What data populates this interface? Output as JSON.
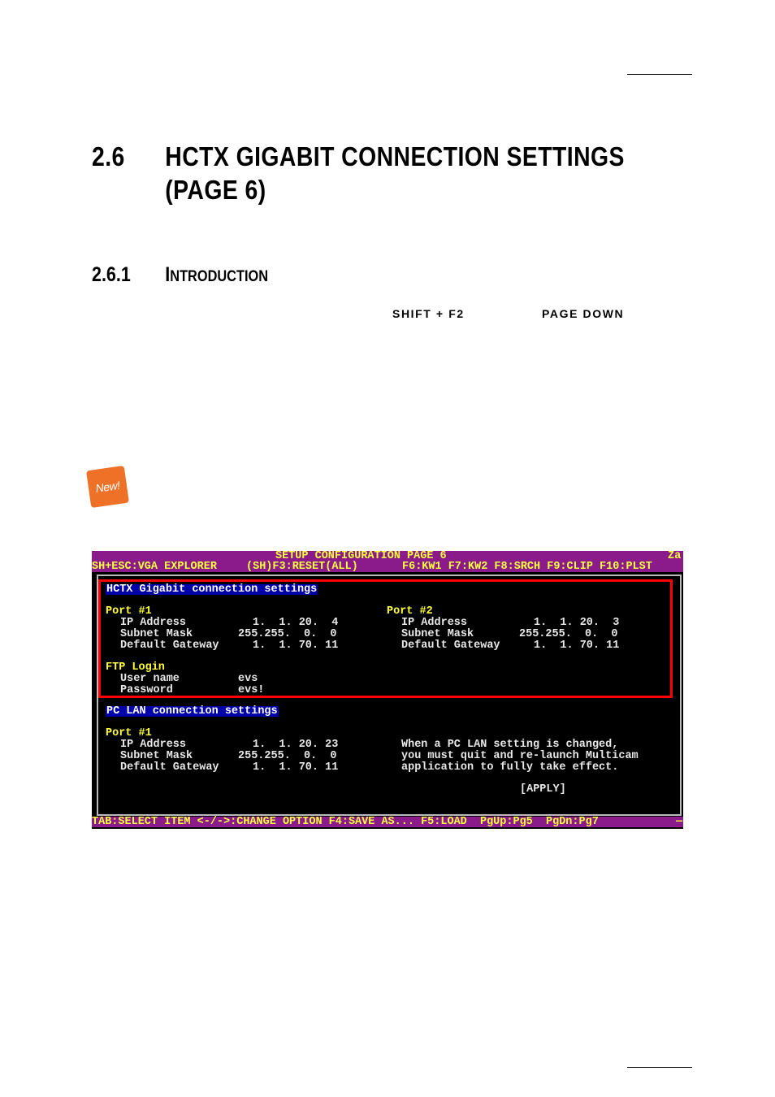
{
  "heading": {
    "number": "2.6",
    "title_line1": "HCTX GIGABIT CONNECTION SETTINGS",
    "title_line2": "(PAGE 6)"
  },
  "subheading": {
    "number": "2.6.1",
    "cap": "I",
    "rest": "NTRODUCTION"
  },
  "keys": {
    "shift_f2": "SHIFT + F2",
    "page_down": "PAGE DOWN"
  },
  "badge": {
    "label": "New!"
  },
  "screen": {
    "title": "SETUP CONFIGURATION PAGE 6",
    "title_right": "Za",
    "menu_left": "SH+ESC:VGA EXPLORER",
    "menu_mid": "(SH)F3:RESET(ALL)",
    "menu_right": "F6:KW1 F7:KW2 F8:SRCH F9:CLIP F10:PLST",
    "hctx": {
      "section_title": "HCTX Gigabit connection settings",
      "port1": {
        "label": "Port #1",
        "ip_label": "IP Address",
        "ip_value": "1.  1. 20.  4",
        "mask_label": "Subnet Mask",
        "mask_value": "255.255.  0.  0",
        "gw_label": "Default Gateway",
        "gw_value": "1.  1. 70. 11"
      },
      "port2": {
        "label": "Port #2",
        "ip_label": "IP Address",
        "ip_value": "1.  1. 20.  3",
        "mask_label": "Subnet Mask",
        "mask_value": "255.255.  0.  0",
        "gw_label": "Default Gateway",
        "gw_value": "1.  1. 70. 11"
      },
      "ftp": {
        "label": "FTP Login",
        "user_label": "User name",
        "user_value": "evs",
        "pass_label": "Password",
        "pass_value": "evs!"
      }
    },
    "pclan": {
      "section_title": "PC LAN connection settings",
      "port1": {
        "label": "Port #1",
        "ip_label": "IP Address",
        "ip_value": "1.  1. 20. 23",
        "mask_label": "Subnet Mask",
        "mask_value": "255.255.  0.  0",
        "gw_label": "Default Gateway",
        "gw_value": "1.  1. 70. 11"
      },
      "note_line1": "When a PC LAN setting is changed,",
      "note_line2": "you must quit and re-launch Multicam",
      "note_line3": "application to fully take effect.",
      "apply_label": "[APPLY]"
    },
    "footer": "TAB:SELECT ITEM <-/->:CHANGE OPTION F4:SAVE AS... F5:LOAD  PgUp:Pg5  PgDn:Pg7",
    "footer_end": "—"
  }
}
